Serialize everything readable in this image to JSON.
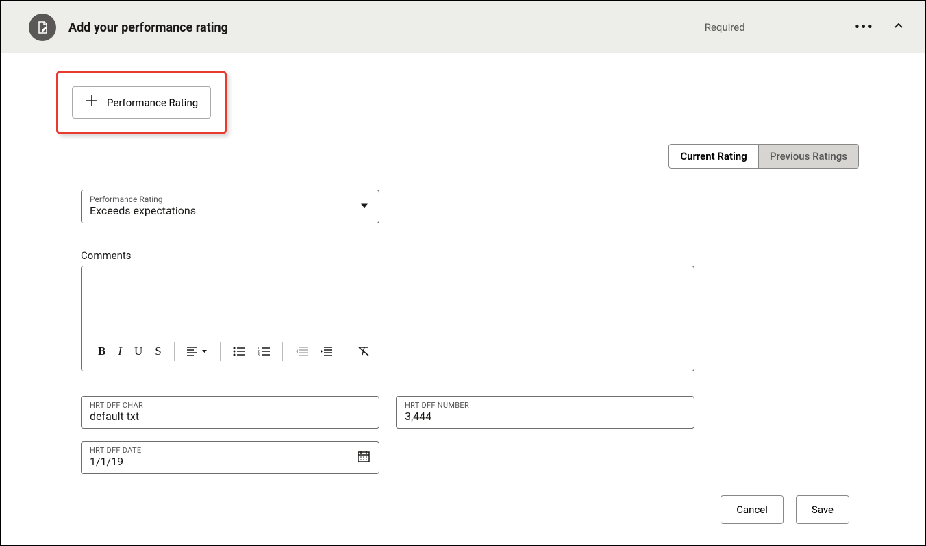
{
  "header": {
    "title": "Add your performance rating",
    "required_label": "Required"
  },
  "add_button": {
    "label": "Performance Rating"
  },
  "tabs": {
    "current": "Current Rating",
    "previous": "Previous Ratings"
  },
  "perf_select": {
    "label": "Performance Rating",
    "value": "Exceeds expectations"
  },
  "comments": {
    "label": "Comments"
  },
  "fields": {
    "char": {
      "label": "HRT DFF CHAR",
      "value": "default txt"
    },
    "number": {
      "label": "HRT DFF NUMBER",
      "value": "3,444"
    },
    "date": {
      "label": "HRT DFF DATE",
      "value": "1/1/19"
    }
  },
  "footer": {
    "cancel": "Cancel",
    "save": "Save"
  }
}
